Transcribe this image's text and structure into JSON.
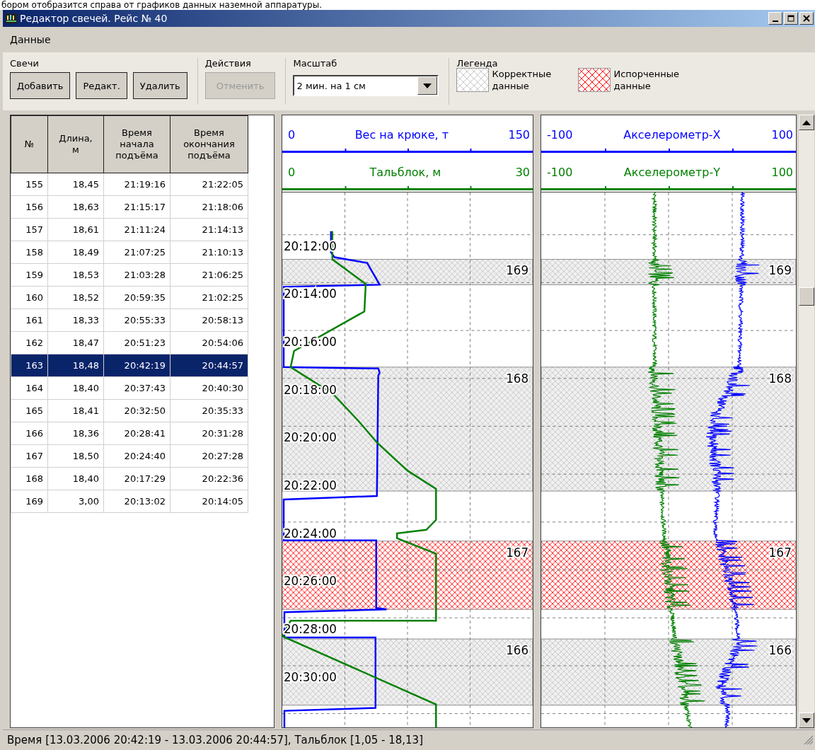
{
  "caption": "бором отобразится справа от графиков данных наземной аппаратуры.",
  "window": {
    "title": "Редактор свечей. Рейс № 40"
  },
  "menu": [
    "Данные"
  ],
  "toolbar": [
    {
      "kind": "buttons",
      "label": "Свечи",
      "buttons": [
        {
          "label": "Добавить",
          "disabled": false
        },
        {
          "label": "Редакт.",
          "disabled": false
        },
        {
          "label": "Удалить",
          "disabled": false
        }
      ]
    },
    {
      "kind": "buttons",
      "label": "Действия",
      "buttons": [
        {
          "label": "Отменить",
          "disabled": true
        }
      ]
    },
    {
      "kind": "select",
      "label": "Масштаб",
      "value": "2 мин. на 1 см"
    },
    {
      "kind": "legend",
      "label": "Легенда",
      "items": [
        {
          "kind": "correct",
          "label": "Корректные данные"
        },
        {
          "kind": "corrupt",
          "label": "Испорченные данные"
        }
      ]
    }
  ],
  "table": {
    "columns": [
      "№",
      "Длина, м",
      "Время начала подъёма",
      "Время окончания подъёма"
    ],
    "rows": [
      {
        "cells": [
          "155",
          "18,45",
          "21:19:16",
          "21:22:05"
        ],
        "selected": false
      },
      {
        "cells": [
          "156",
          "18,63",
          "21:15:17",
          "21:18:06"
        ],
        "selected": false
      },
      {
        "cells": [
          "157",
          "18,61",
          "21:11:24",
          "21:14:13"
        ],
        "selected": false
      },
      {
        "cells": [
          "158",
          "18,49",
          "21:07:25",
          "21:10:13"
        ],
        "selected": false
      },
      {
        "cells": [
          "159",
          "18,53",
          "21:03:28",
          "21:06:25"
        ],
        "selected": false
      },
      {
        "cells": [
          "160",
          "18,52",
          "20:59:35",
          "21:02:25"
        ],
        "selected": false
      },
      {
        "cells": [
          "161",
          "18,33",
          "20:55:33",
          "20:58:13"
        ],
        "selected": false
      },
      {
        "cells": [
          "162",
          "18,47",
          "20:51:23",
          "20:54:06"
        ],
        "selected": false
      },
      {
        "cells": [
          "163",
          "18,48",
          "20:42:19",
          "20:44:57"
        ],
        "selected": true
      },
      {
        "cells": [
          "164",
          "18,40",
          "20:37:43",
          "20:40:30"
        ],
        "selected": false
      },
      {
        "cells": [
          "165",
          "18,41",
          "20:32:50",
          "20:35:33"
        ],
        "selected": false
      },
      {
        "cells": [
          "166",
          "18,36",
          "20:28:41",
          "20:31:28"
        ],
        "selected": false
      },
      {
        "cells": [
          "167",
          "18,50",
          "20:24:40",
          "20:27:28"
        ],
        "selected": false
      },
      {
        "cells": [
          "168",
          "18,40",
          "20:17:29",
          "20:22:36"
        ],
        "selected": false
      },
      {
        "cells": [
          "169",
          "3,00",
          "20:13:02",
          "20:14:05"
        ],
        "selected": false
      }
    ]
  },
  "chart_panels": [
    {
      "kind": "hook",
      "axes": [
        {
          "min": "0",
          "title": "Вес на крюке, т",
          "max": "150",
          "color": "#0000ff"
        },
        {
          "min": "0",
          "title": "Тальблок, м",
          "max": "30",
          "color": "#008000"
        }
      ],
      "time_labels": [
        "20:12:00",
        "20:14:00",
        "20:16:00",
        "20:18:00",
        "20:20:00",
        "20:22:00",
        "20:24:00",
        "20:26:00",
        "20:28:00",
        "20:30:00"
      ],
      "bands": [
        {
          "label": "169",
          "kind": "correct"
        },
        {
          "label": "168",
          "kind": "correct"
        },
        {
          "label": "167",
          "kind": "corrupt"
        },
        {
          "label": "166",
          "kind": "correct"
        }
      ]
    },
    {
      "kind": "accel",
      "axes": [
        {
          "min": "-100",
          "title": "Акселерометр-X",
          "max": "100",
          "color": "#0000ff"
        },
        {
          "min": "-100",
          "title": "Акселерометр-Y",
          "max": "100",
          "color": "#008000"
        }
      ],
      "bands": [
        {
          "label": "169",
          "kind": "correct"
        },
        {
          "label": "168",
          "kind": "correct"
        },
        {
          "label": "167",
          "kind": "corrupt"
        },
        {
          "label": "166",
          "kind": "correct"
        }
      ]
    }
  ],
  "status_bar": "Время [13.03.2006 20:42:19 - 13.03.2006 20:44:57], Тальблок [1,05 - 18,13]"
}
